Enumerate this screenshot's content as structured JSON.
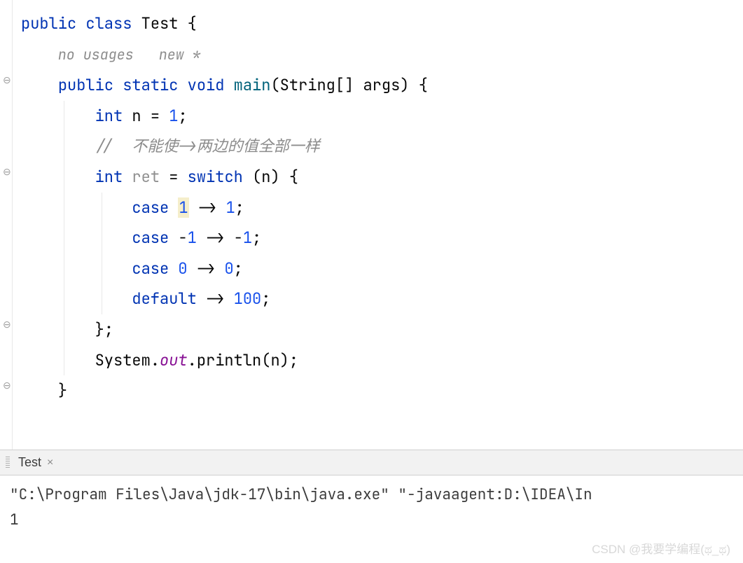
{
  "code": {
    "kw_public": "public",
    "kw_class": "class",
    "cls_name": "Test",
    "lbrace": "{",
    "hint_usages": "no usages",
    "hint_new": "new *",
    "kw_static": "static",
    "kw_void": "void",
    "fn_main": "main",
    "param_type": "String[] ",
    "param_name": "args",
    "kw_int": "int",
    "var_n": "n",
    "eq": " = ",
    "one": "1",
    "semi": ";",
    "comment": "//  不能使->两边的值全部一样",
    "var_ret": "ret",
    "kw_switch": "switch",
    "open_paren": "(",
    "close_paren": ")",
    "kw_case": "case",
    "arrow": " -> ",
    "neg1": "-1",
    "zero": "0",
    "kw_default": "default",
    "hundred": "100",
    "rbrace": "}",
    "sys": "System",
    "dot": ".",
    "out": "out",
    "println": "println"
  },
  "tab": {
    "label": "Test",
    "close": "×"
  },
  "console": {
    "cmd": "\"C:\\Program Files\\Java\\jdk-17\\bin\\java.exe\" \"-javaagent:D:\\IDEA\\In",
    "output": "1"
  },
  "watermark": "CSDN @我要学编程(ಥ_ಥ)"
}
